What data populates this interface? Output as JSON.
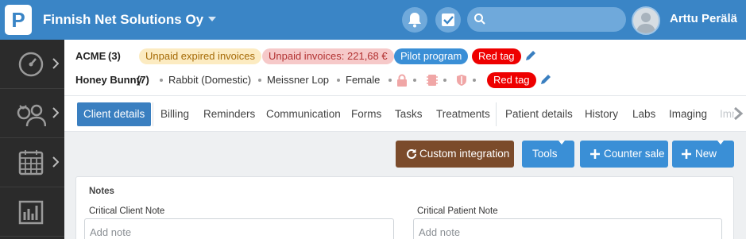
{
  "app": {
    "logo_letter": "P",
    "organization": "Finnish Net Solutions Oy",
    "user_name": "Arttu Perälä",
    "search_placeholder": ""
  },
  "client": {
    "name": "ACME",
    "count": "(3)",
    "badges": [
      "Unpaid expired invoices",
      "Unpaid invoices: 221,68 €",
      "Pilot program",
      "Red tag"
    ]
  },
  "patient": {
    "name": "Honey Bunny",
    "count": "(7)",
    "species": "Rabbit (Domestic)",
    "breed": "Meissner Lop",
    "sex": "Female",
    "tag": "Red tag"
  },
  "tabs": [
    "Client details",
    "Billing",
    "Reminders",
    "Communication",
    "Forms",
    "Tasks",
    "Treatments",
    "Patient details",
    "History",
    "Labs",
    "Imaging",
    "Imr"
  ],
  "actions": {
    "custom_integration": "Custom integration",
    "tools": "Tools",
    "counter_sale": "Counter sale",
    "new": "New"
  },
  "notes": {
    "title": "Notes",
    "client_label": "Critical Client Note",
    "patient_label": "Critical Patient Note",
    "client_placeholder": "Add note",
    "patient_placeholder": "Add note"
  },
  "colors": {
    "topbar": "#3a85c6",
    "sidebar": "#2b2b2b",
    "brown_button": "#7b4b2b",
    "blue_button": "#3a8fd6",
    "red_tag": "#ee0000"
  }
}
